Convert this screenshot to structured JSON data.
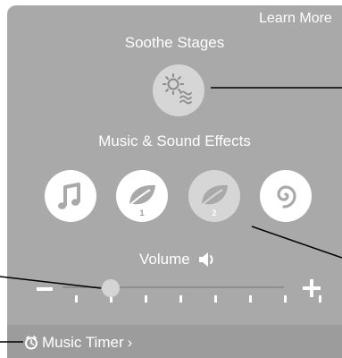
{
  "header": {
    "learn_more": "Learn More"
  },
  "soothe": {
    "title": "Soothe Stages",
    "button_icon": "sun-waves-icon"
  },
  "effects": {
    "title": "Music & Sound Effects",
    "buttons": [
      {
        "icon": "music-note-icon",
        "label": "",
        "active": true
      },
      {
        "icon": "leaf-icon",
        "label": "1",
        "active": true
      },
      {
        "icon": "leaf-icon",
        "label": "2",
        "active": false
      },
      {
        "icon": "spiral-icon",
        "label": "",
        "active": true
      }
    ]
  },
  "volume": {
    "label": "Volume",
    "icon": "speaker-icon",
    "level": 0.25,
    "steps": 8
  },
  "timer": {
    "label": "Music Timer",
    "icon": "timer-icon",
    "chevron": "›"
  },
  "colors": {
    "panel": "#a9a9a9",
    "timer_bar": "#9c9c9c",
    "text": "#ffffff",
    "inactive_button": "#d6d6d6"
  }
}
